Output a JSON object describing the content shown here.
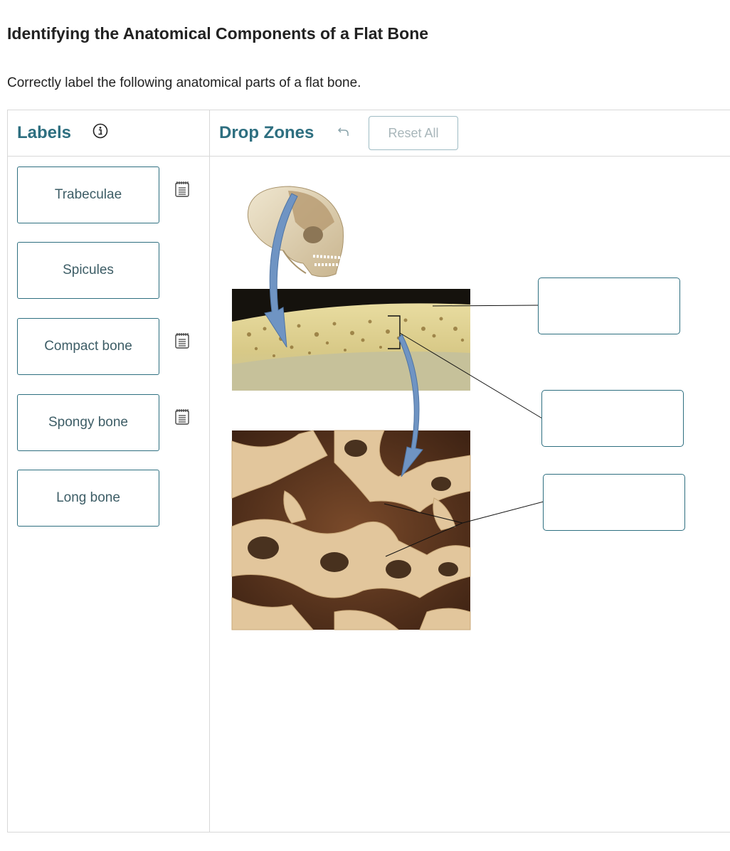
{
  "page": {
    "title": "Identifying the Anatomical Components of a Flat Bone",
    "instructions": "Correctly label the following anatomical parts of a flat bone."
  },
  "labels_panel": {
    "heading": "Labels",
    "info_icon": "info-circle-icon",
    "items": [
      {
        "label": "Trabeculae",
        "has_hint": true
      },
      {
        "label": "Spicules",
        "has_hint": false
      },
      {
        "label": "Compact bone",
        "has_hint": true
      },
      {
        "label": "Spongy bone",
        "has_hint": true
      },
      {
        "label": "Long bone",
        "has_hint": false
      }
    ],
    "hint_icon": "notepad-icon"
  },
  "drop_zones_panel": {
    "heading": "Drop Zones",
    "undo_icon": "undo-arrow-icon",
    "reset_label": "Reset All",
    "zones": [
      {
        "value": ""
      },
      {
        "value": ""
      },
      {
        "value": ""
      }
    ]
  },
  "colors": {
    "accent": "#2e6f80",
    "label_text": "#3d5d66",
    "border": "#d8d8d8",
    "arrow": "#6f94c3"
  }
}
